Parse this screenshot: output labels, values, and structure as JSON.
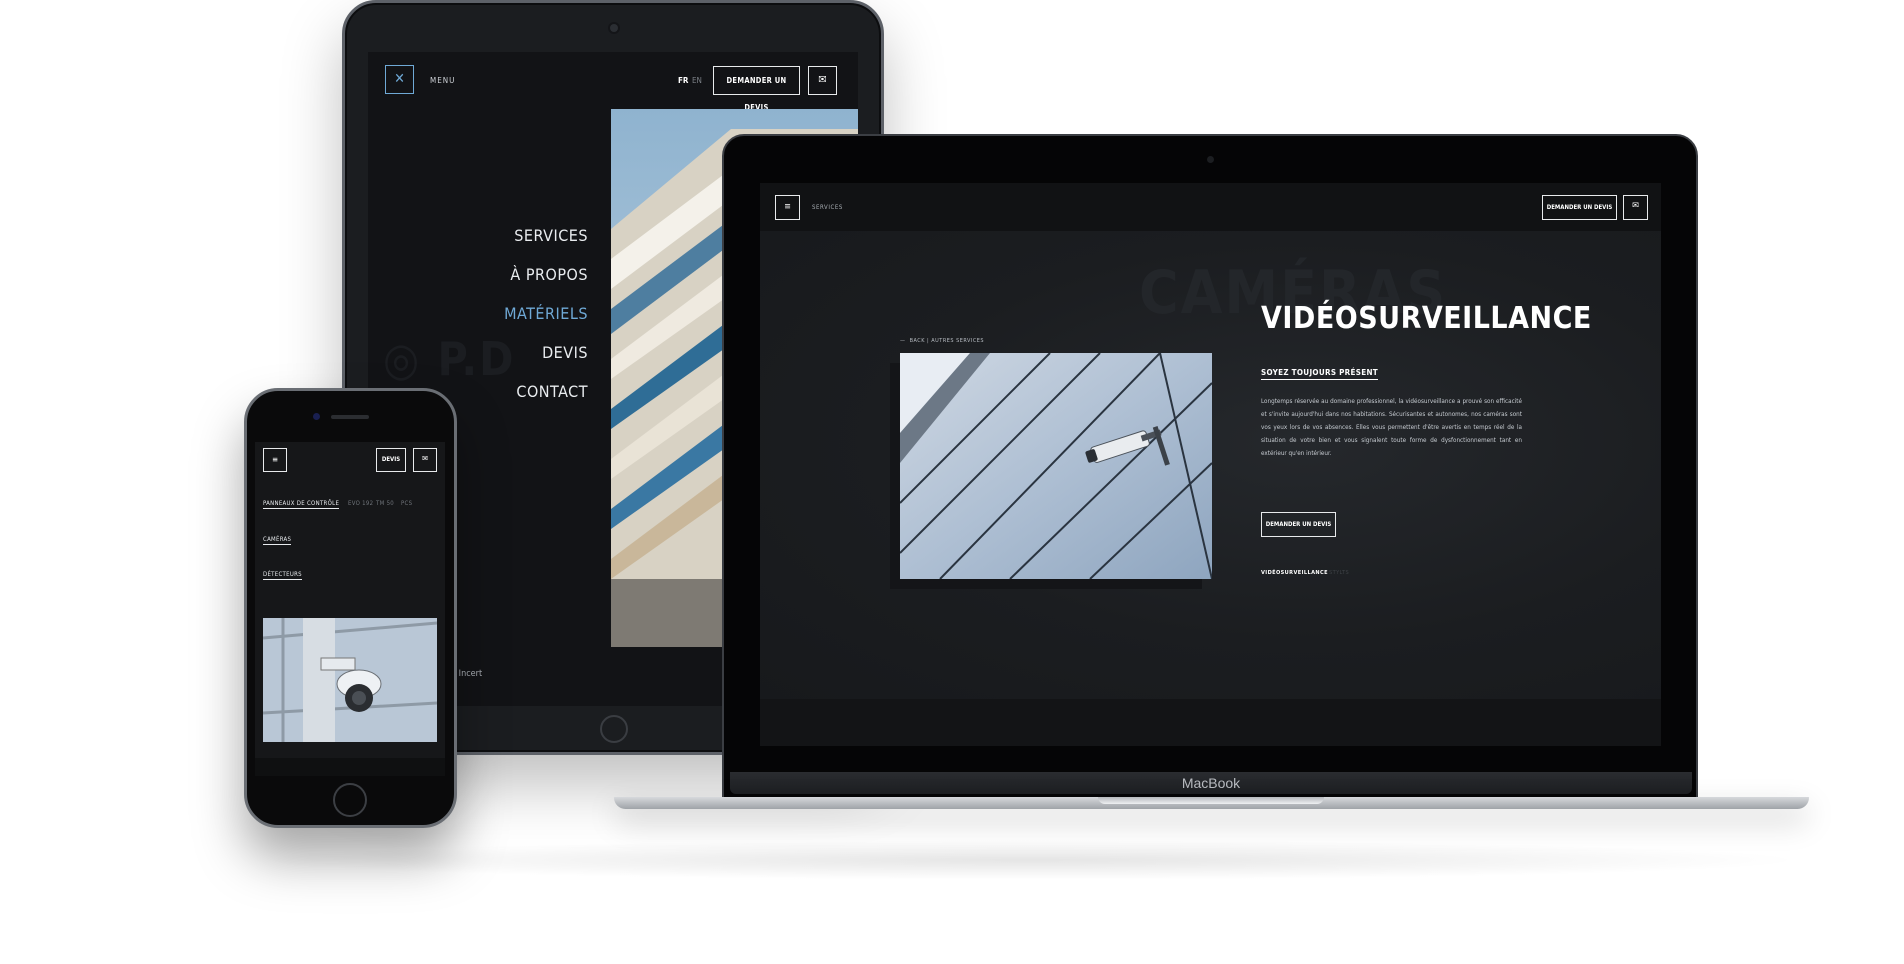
{
  "tablet": {
    "menu_label": "MENU",
    "lang_fr": "FR",
    "lang_en": "EN",
    "quote_button": "DEMANDER UN DEVIS",
    "menu_items": [
      "SERVICES",
      "À PROPOS",
      "MATÉRIELS",
      "DEVIS",
      "CONTACT"
    ],
    "active_item": "MATÉRIELS",
    "footer_text": "re Incert"
  },
  "laptop": {
    "nav_label": "SERVICES",
    "quote_button": "DEMANDER UN DEVIS",
    "breadcrumb": "BACK  |  AUTRES SERVICES",
    "ghost_word": "CAMÉRAS",
    "title": "VIDÉOSURVEILLANCE",
    "subtitle": "SOYEZ TOUJOURS PRÉSENT",
    "paragraph": "Longtemps réservée au domaine professionnel, la vidéosurveillance a prouvé son efficacité et s'invite aujourd'hui dans nos habitations. Sécurisantes et autonomes, nos caméras sont vos yeux lors de vos absences. Elles vous permettent d'être avertis en temps réel de la situation de votre bien et vous signalent toute forme de dysfonctionnement tant en extérieur qu'en intérieur.",
    "cta_button": "DEMANDER UN DEVIS",
    "tags": [
      "VIDÉOSURVEILLANCE",
      "STYLTS"
    ],
    "brand": "MacBook"
  },
  "phone": {
    "quote_button": "DEVIS",
    "tabs": [
      "PANNEAUX DE CONTRÔLE",
      "EVO 192",
      "TM 50",
      "PCS"
    ],
    "categories": [
      "CAMÉRAS",
      "DÉTECTEURS"
    ]
  },
  "icons": {
    "close": "close-icon",
    "burger": "hamburger-menu-icon",
    "mail": "mail-icon"
  },
  "colors": {
    "accent": "#6fa9d6",
    "screen_bg": "#16181b",
    "text": "#e9ecef"
  }
}
